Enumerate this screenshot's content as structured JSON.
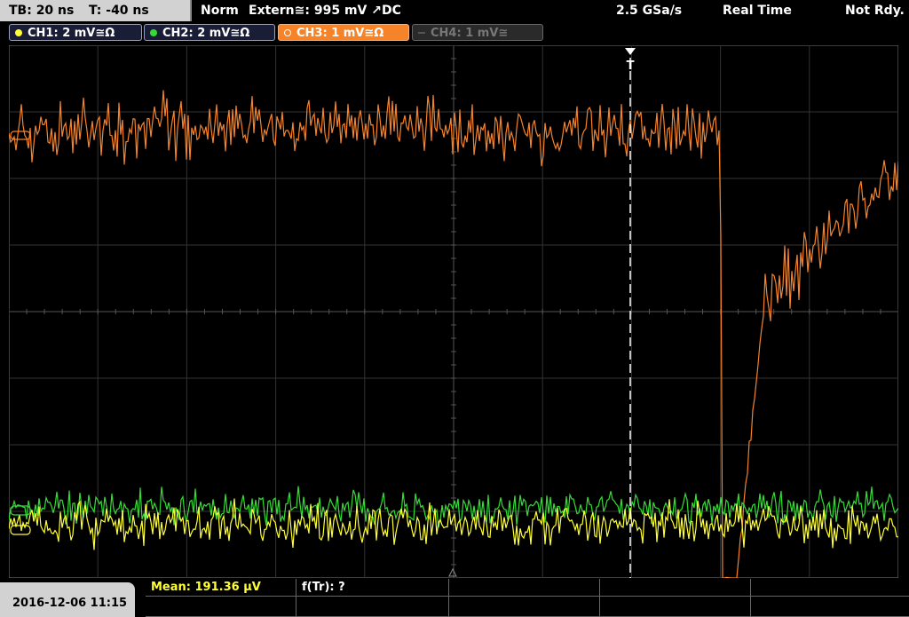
{
  "header": {
    "timebase": "TB: 20 ns",
    "trigger_time": "T: -40 ns",
    "trigger_mode": "Norm",
    "trigger_source": "Extern≅: 995 mV ↗DC",
    "sample_rate": "2.5 GSa/s",
    "acq_mode": "Real Time",
    "status": "Not Rdy."
  },
  "channels": [
    {
      "label": "CH1: 2 mV≅Ω",
      "color": "#ffff33",
      "state": "on"
    },
    {
      "label": "CH2: 2 mV≅Ω",
      "color": "#33dd33",
      "state": "on"
    },
    {
      "label": "CH3: 1 mV≅Ω",
      "color": "#f5832a",
      "state": "active"
    },
    {
      "label": "CH4: 1 mV≅",
      "color": "#777777",
      "state": "off"
    }
  ],
  "markers": {
    "trigger_label": "T"
  },
  "footer": {
    "datetime": "2016-12-06 11:15",
    "measure_1": "Mean: 191.36 µV",
    "measure_2": "f(Tr): ?"
  },
  "colors": {
    "ch1": "#ffff33",
    "ch2": "#33dd33",
    "ch3": "#f5832a",
    "grid": "#3a3a3a",
    "trigger_cursor": "#ffffff"
  }
}
